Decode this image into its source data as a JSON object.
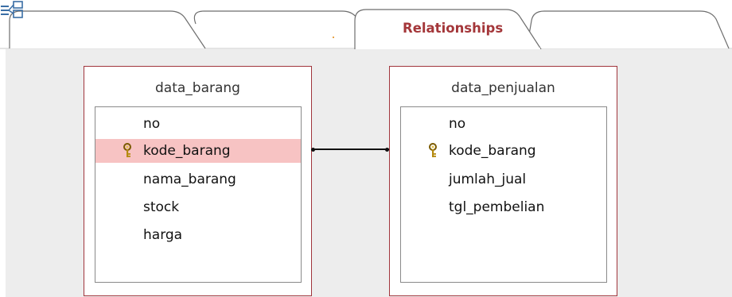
{
  "tabs": [
    {
      "label": ""
    },
    {
      "label": ""
    },
    {
      "label": "Relationships",
      "active": true,
      "icon": "relationships-icon"
    },
    {
      "label": ""
    }
  ],
  "colors": {
    "accent": "#a4373a",
    "table_border": "#a0353c",
    "selected_row": "#f7c3c3",
    "canvas": "#ededed"
  },
  "tables": [
    {
      "title": "data_barang",
      "fields": [
        {
          "name": "no",
          "key": false,
          "selected": false
        },
        {
          "name": "kode_barang",
          "key": true,
          "selected": true
        },
        {
          "name": "nama_barang",
          "key": false,
          "selected": false
        },
        {
          "name": "stock",
          "key": false,
          "selected": false
        },
        {
          "name": "harga",
          "key": false,
          "selected": false
        }
      ]
    },
    {
      "title": "data_penjualan",
      "fields": [
        {
          "name": "no",
          "key": false,
          "selected": false
        },
        {
          "name": "kode_barang",
          "key": true,
          "selected": false
        },
        {
          "name": "jumlah_jual",
          "key": false,
          "selected": false
        },
        {
          "name": "tgl_pembelian",
          "key": false,
          "selected": false
        }
      ]
    }
  ],
  "relationship": {
    "from": "data_barang.kode_barang",
    "to": "data_penjualan.kode_barang"
  }
}
